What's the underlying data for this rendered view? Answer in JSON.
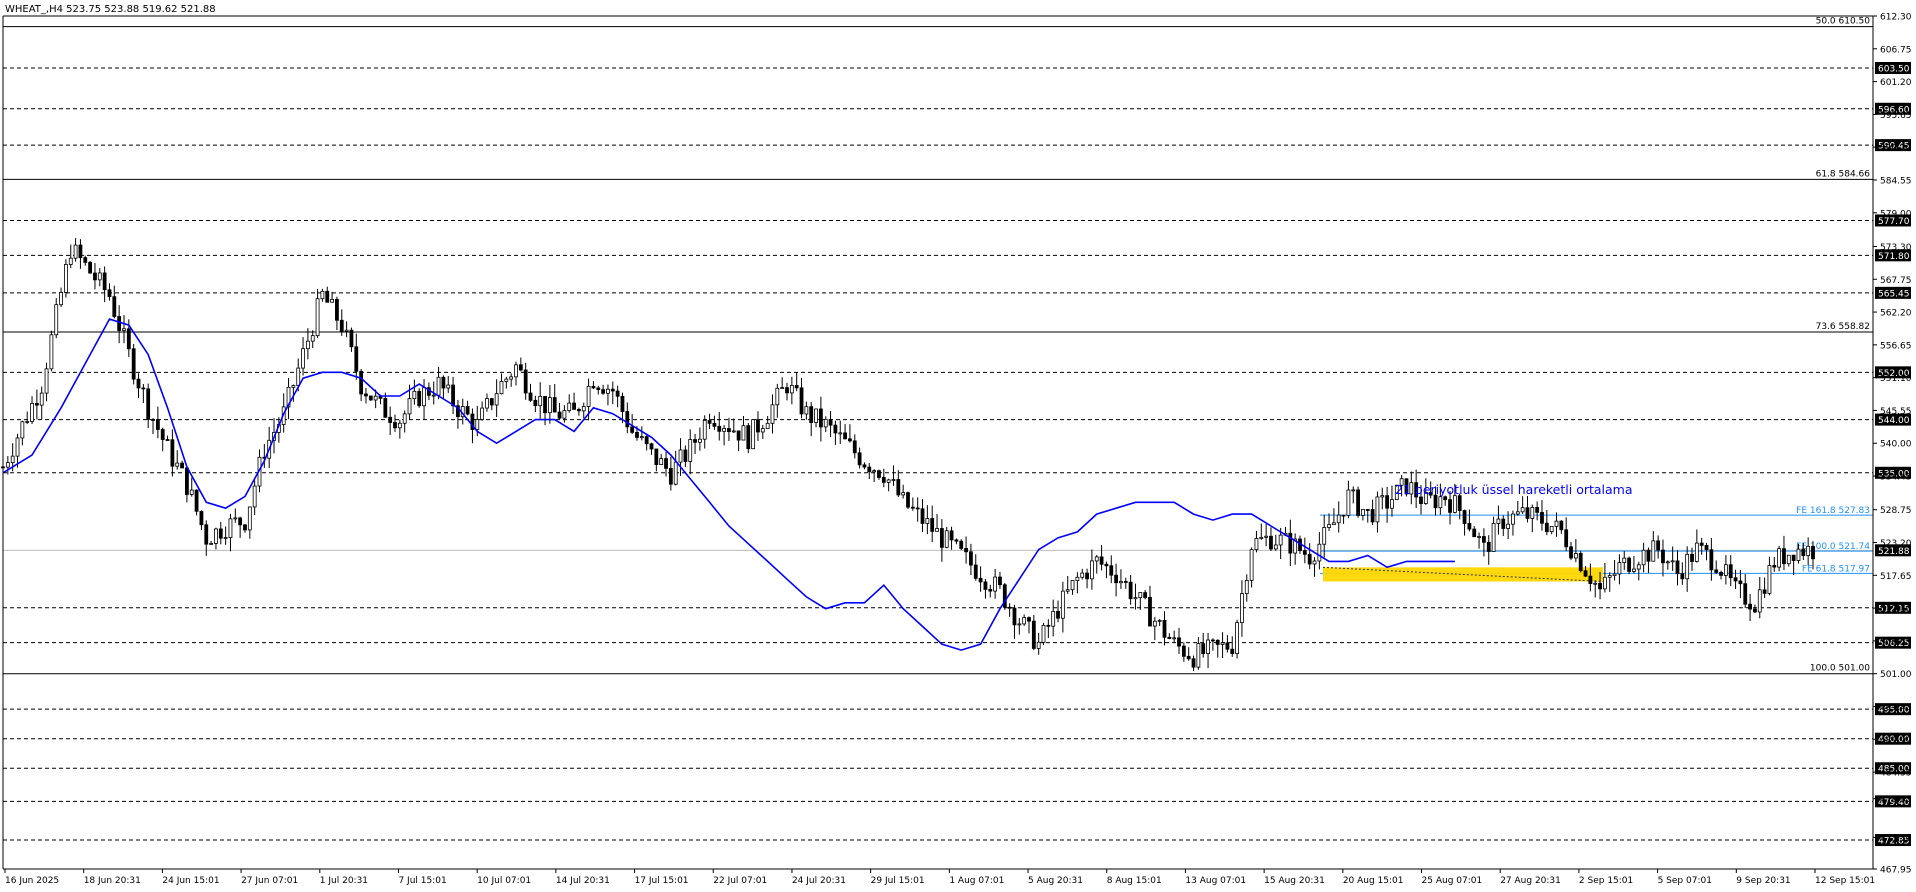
{
  "header": {
    "symbol_line": "WHEAT_,H4  523.75 523.88 519.62 521.88"
  },
  "annotation": {
    "ema_note": "21 periyotluk üssel hareketli ortalama"
  },
  "colors": {
    "background": "#ffffff",
    "axis": "#000000",
    "candle": "#000000",
    "ema": "#0000ff",
    "fe_line": "#1e90ff",
    "zone": "#ffd700",
    "annotation_text": "#0000ff"
  },
  "chart_data": {
    "type": "candlestick",
    "title": "WHEAT_,H4  523.75 523.88 519.62 521.88",
    "ylim": [
      467.95,
      612.3
    ],
    "grid": false,
    "x_tick_labels": [
      "16 Jun 2025",
      "18 Jun 20:31",
      "24 Jun 15:01",
      "27 Jun 07:01",
      "1 Jul 20:31",
      "7 Jul 15:01",
      "10 Jul 07:01",
      "14 Jul 20:31",
      "17 Jul 15:01",
      "22 Jul 07:01",
      "24 Jul 20:31",
      "29 Jul 15:01",
      "1 Aug 07:01",
      "5 Aug 20:31",
      "8 Aug 15:01",
      "13 Aug 07:01",
      "15 Aug 20:31",
      "20 Aug 15:01",
      "25 Aug 07:01",
      "27 Aug 20:31",
      "2 Sep 15:01",
      "5 Sep 07:01",
      "9 Sep 20:31",
      "12 Sep 15:01"
    ],
    "y_tick_labels": [
      "612.30",
      "606.75",
      "601.20",
      "595.65",
      "590.10",
      "584.55",
      "579.00",
      "573.30",
      "567.75",
      "562.20",
      "556.65",
      "551.10",
      "545.55",
      "540.00",
      "534.45",
      "528.75",
      "523.20",
      "517.65",
      "512.10",
      "506.55",
      "501.00",
      "495.45",
      "489.90",
      "484.35",
      "479.85",
      "473.30",
      "467.95"
    ],
    "horizontal_levels": [
      {
        "value": 603.5,
        "label": "603.50",
        "style": "dashed"
      },
      {
        "value": 596.6,
        "label": "596.60",
        "style": "dashed"
      },
      {
        "value": 590.45,
        "label": "590.45",
        "style": "dashed"
      },
      {
        "value": 577.7,
        "label": "577.70",
        "style": "dashed"
      },
      {
        "value": 571.8,
        "label": "571.80",
        "style": "dashed"
      },
      {
        "value": 565.45,
        "label": "565.45",
        "style": "dashed"
      },
      {
        "value": 552.0,
        "label": "552.00",
        "style": "dashed"
      },
      {
        "value": 544.0,
        "label": "544.00",
        "style": "dashed"
      },
      {
        "value": 535.0,
        "label": "535.00",
        "style": "dashed"
      },
      {
        "value": 512.15,
        "label": "512.15",
        "style": "dashed"
      },
      {
        "value": 506.25,
        "label": "506.25",
        "style": "dashed"
      },
      {
        "value": 495.0,
        "label": "495.00",
        "style": "dashed"
      },
      {
        "value": 490.0,
        "label": "490.00",
        "style": "dashed"
      },
      {
        "value": 485.0,
        "label": "485.00",
        "style": "dashed"
      },
      {
        "value": 479.4,
        "label": "479.40",
        "style": "dashed"
      },
      {
        "value": 472.85,
        "label": "472.85",
        "style": "dashed"
      }
    ],
    "fibo_levels": [
      {
        "value": 610.5,
        "label": "50.0 610.50"
      },
      {
        "value": 584.66,
        "label": "61.8 584.66"
      },
      {
        "value": 558.82,
        "label": "73.6 558.82"
      },
      {
        "value": 501.0,
        "label": "100.0 501.00"
      }
    ],
    "fe_levels": [
      {
        "value": 527.83,
        "label": "FE 161.8 527.83"
      },
      {
        "value": 521.74,
        "label": "FE 100.0 521.74"
      },
      {
        "value": 517.97,
        "label": "FE 61.8 517.97"
      }
    ],
    "current_price": {
      "value": 521.88,
      "label": "521.88"
    },
    "zone": {
      "low": 516.6,
      "high": 519.0
    },
    "price_path": [
      [
        0,
        536
      ],
      [
        4,
        550
      ],
      [
        7,
        573
      ],
      [
        9,
        569
      ],
      [
        11,
        565
      ],
      [
        13,
        555
      ],
      [
        15,
        546
      ],
      [
        17,
        539
      ],
      [
        19,
        533
      ],
      [
        21,
        524
      ],
      [
        23,
        526
      ],
      [
        25,
        527
      ],
      [
        27,
        539
      ],
      [
        29,
        545
      ],
      [
        31,
        555
      ],
      [
        33,
        565
      ],
      [
        35,
        560
      ],
      [
        37,
        550
      ],
      [
        39,
        546
      ],
      [
        41,
        544
      ],
      [
        43,
        548
      ],
      [
        45,
        550
      ],
      [
        47,
        546
      ],
      [
        49,
        543
      ],
      [
        51,
        549
      ],
      [
        53,
        553
      ],
      [
        55,
        548
      ],
      [
        57,
        545
      ],
      [
        59,
        545
      ],
      [
        61,
        551
      ],
      [
        63,
        549
      ],
      [
        65,
        542
      ],
      [
        67,
        538
      ],
      [
        69,
        535
      ],
      [
        71,
        539
      ],
      [
        73,
        545
      ],
      [
        75,
        543
      ],
      [
        77,
        541
      ],
      [
        79,
        545
      ],
      [
        81,
        550
      ],
      [
        83,
        545
      ],
      [
        85,
        543
      ],
      [
        87,
        540
      ],
      [
        89,
        537
      ],
      [
        91,
        535
      ],
      [
        93,
        530
      ],
      [
        95,
        527
      ],
      [
        97,
        524
      ],
      [
        99,
        521
      ],
      [
        101,
        518
      ],
      [
        103,
        515
      ],
      [
        105,
        510
      ],
      [
        107,
        506
      ],
      [
        109,
        512
      ],
      [
        111,
        517
      ],
      [
        113,
        520
      ],
      [
        115,
        518
      ],
      [
        117,
        514
      ],
      [
        119,
        510
      ],
      [
        121,
        506
      ],
      [
        123,
        504
      ],
      [
        125,
        505
      ],
      [
        127,
        506
      ],
      [
        129,
        523
      ],
      [
        131,
        524
      ],
      [
        133,
        523
      ],
      [
        135,
        521
      ],
      [
        137,
        525
      ],
      [
        139,
        531
      ],
      [
        141,
        528
      ],
      [
        143,
        530
      ],
      [
        145,
        533
      ],
      [
        147,
        530
      ],
      [
        149,
        531
      ],
      [
        151,
        528
      ],
      [
        153,
        522
      ],
      [
        155,
        527
      ],
      [
        157,
        528
      ],
      [
        159,
        527
      ],
      [
        161,
        525
      ],
      [
        163,
        520
      ],
      [
        165,
        515
      ],
      [
        167,
        519
      ],
      [
        169,
        521
      ],
      [
        171,
        522
      ],
      [
        173,
        518
      ],
      [
        175,
        522
      ],
      [
        177,
        520
      ],
      [
        179,
        515
      ],
      [
        181,
        513
      ],
      [
        183,
        520
      ],
      [
        185,
        522
      ],
      [
        187,
        522
      ]
    ],
    "ema_path": [
      [
        0,
        535
      ],
      [
        3,
        538
      ],
      [
        6,
        546
      ],
      [
        9,
        555
      ],
      [
        11,
        561
      ],
      [
        13,
        560
      ],
      [
        15,
        555
      ],
      [
        17,
        546
      ],
      [
        19,
        536
      ],
      [
        21,
        530
      ],
      [
        23,
        529
      ],
      [
        25,
        531
      ],
      [
        27,
        537
      ],
      [
        29,
        545
      ],
      [
        31,
        551
      ],
      [
        33,
        552
      ],
      [
        35,
        552
      ],
      [
        37,
        551
      ],
      [
        39,
        548
      ],
      [
        41,
        548
      ],
      [
        43,
        550
      ],
      [
        45,
        548
      ],
      [
        47,
        546
      ],
      [
        49,
        542
      ],
      [
        51,
        540
      ],
      [
        53,
        542
      ],
      [
        55,
        544
      ],
      [
        57,
        544
      ],
      [
        59,
        542
      ],
      [
        61,
        546
      ],
      [
        63,
        545
      ],
      [
        65,
        543
      ],
      [
        67,
        541
      ],
      [
        69,
        538
      ],
      [
        71,
        534
      ],
      [
        73,
        530
      ],
      [
        75,
        526
      ],
      [
        77,
        523
      ],
      [
        79,
        520
      ],
      [
        81,
        517
      ],
      [
        83,
        514
      ],
      [
        85,
        512
      ],
      [
        87,
        513
      ],
      [
        89,
        513
      ],
      [
        91,
        516
      ],
      [
        93,
        512
      ],
      [
        95,
        509
      ],
      [
        97,
        506
      ],
      [
        99,
        505
      ],
      [
        101,
        506
      ],
      [
        103,
        512
      ],
      [
        105,
        517
      ],
      [
        107,
        522
      ],
      [
        109,
        524
      ],
      [
        111,
        525
      ],
      [
        113,
        528
      ],
      [
        115,
        529
      ],
      [
        117,
        530
      ],
      [
        119,
        530
      ],
      [
        121,
        530
      ],
      [
        123,
        528
      ],
      [
        125,
        527
      ],
      [
        127,
        528
      ],
      [
        129,
        528
      ],
      [
        131,
        526
      ],
      [
        133,
        524
      ],
      [
        135,
        522
      ],
      [
        137,
        520
      ],
      [
        139,
        520
      ],
      [
        141,
        521
      ],
      [
        143,
        519
      ],
      [
        145,
        520
      ],
      [
        147,
        520
      ],
      [
        149,
        520
      ],
      [
        150,
        520
      ]
    ],
    "candles": {
      "start_x": 3,
      "spacing": 4.6,
      "ema_period": 21
    }
  }
}
